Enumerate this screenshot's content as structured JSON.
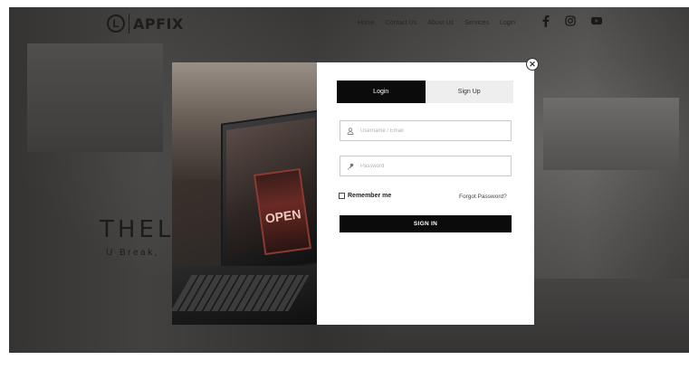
{
  "site": {
    "logo_letter": "L",
    "logo_text": "APFIX",
    "nav": [
      "Home",
      "Contact Us",
      "About Us",
      "Services",
      "Login"
    ],
    "social_icons": [
      "facebook-icon",
      "instagram-icon",
      "youtube-icon"
    ],
    "hero_title": "THEL",
    "hero_subtitle": "U Break,"
  },
  "modal": {
    "photo_sign_text": "OPEN",
    "tabs": [
      {
        "label": "Login",
        "active": true
      },
      {
        "label": "Sign Up",
        "active": false
      }
    ],
    "username_placeholder": "Username / Email",
    "password_placeholder": "Password",
    "remember_label": "Remember me",
    "forgot_label": "Forgot Password?",
    "signin_label": "SIGN IN",
    "close_glyph": "✕"
  },
  "colors": {
    "primary": "#0b0b0b",
    "tab_inactive": "#eeeeee",
    "field_border": "#c9c9c9"
  }
}
